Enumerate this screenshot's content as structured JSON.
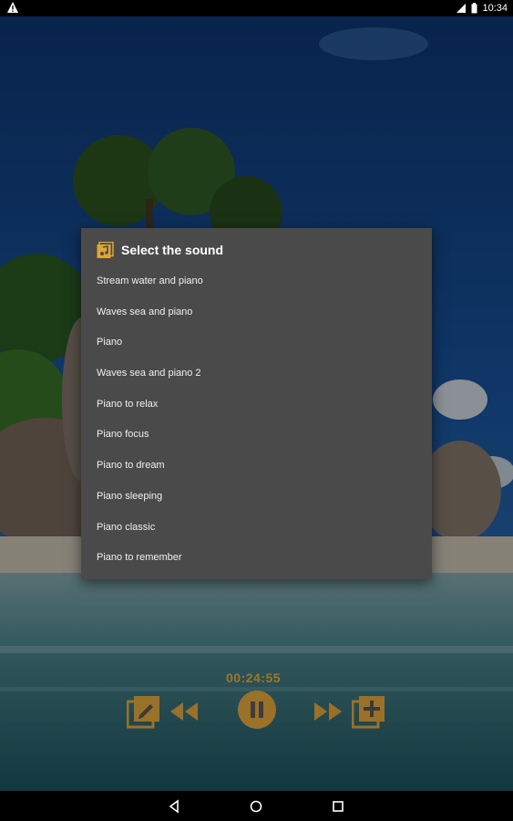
{
  "status_bar": {
    "time": "10:34",
    "icons": [
      "warning-icon",
      "signal-icon",
      "battery-icon"
    ]
  },
  "dialog": {
    "title": "Select the sound",
    "icon": "music-note-icon",
    "items": [
      {
        "label": "Stream water and piano"
      },
      {
        "label": "Waves sea and piano"
      },
      {
        "label": "Piano"
      },
      {
        "label": "Waves sea and piano 2"
      },
      {
        "label": "Piano to relax"
      },
      {
        "label": "Piano focus"
      },
      {
        "label": "Piano to dream"
      },
      {
        "label": "Piano sleeping"
      },
      {
        "label": "Piano classic"
      },
      {
        "label": "Piano to remember"
      }
    ]
  },
  "player": {
    "elapsed": "00:24:55",
    "accent_color": "#a07628",
    "controls": [
      "edit-playlist-icon",
      "rewind-icon",
      "pause-icon",
      "fast-forward-icon",
      "add-to-playlist-icon"
    ]
  },
  "nav_bar": {
    "buttons": [
      "back-icon",
      "home-icon",
      "recents-icon"
    ]
  }
}
